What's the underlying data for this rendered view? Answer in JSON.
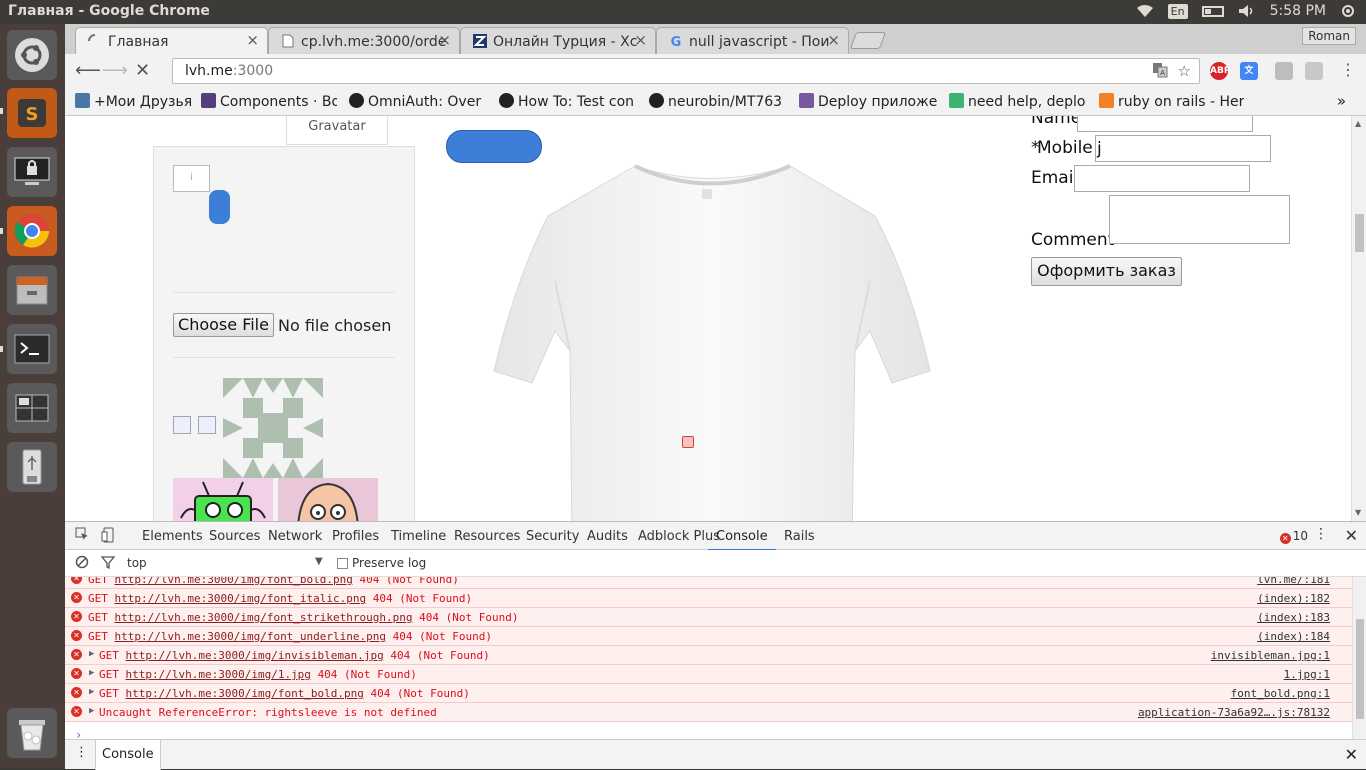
{
  "os": {
    "window_title": "Главная - Google Chrome",
    "language": "En",
    "time": "5:58 PM"
  },
  "launcher": {
    "apps": [
      "ubuntu-dash",
      "sublime-text",
      "lock-screen",
      "chrome",
      "files",
      "terminal",
      "workspaces",
      "usb-drive",
      "trash"
    ]
  },
  "browser": {
    "profile": "Roman",
    "tabs": [
      {
        "label": "Главная",
        "active": true
      },
      {
        "label": "cp.lvh.me:3000/orde",
        "active": false
      },
      {
        "label": "Онлайн Турция - Xc",
        "active": false
      },
      {
        "label": "null javascript - Пои",
        "active": false
      }
    ],
    "address": {
      "host": "lvh.me",
      "port": ":3000"
    },
    "bookmarks": [
      "+Мои Друзья",
      "Components · Bo",
      "OmniAuth: Over",
      "How To: Test con",
      "neurobin/MT763",
      "Deploy приложе",
      "need help, deplo",
      "ruby on rails - Her"
    ],
    "bookmarks_more": "»"
  },
  "page": {
    "gravatar_tab": "Gravatar",
    "small_input_value": "i",
    "choose_file_label": "Choose File",
    "no_file_label": "No file chosen",
    "form": {
      "name_label": "Name",
      "mobile_required": "*",
      "mobile_label": " Mobile",
      "mobile_value": "j",
      "email_label": "Email",
      "comment_label": "Comment",
      "submit_label": "Оформить заказ"
    }
  },
  "devtools": {
    "tabs": [
      "Elements",
      "Sources",
      "Network",
      "Profiles",
      "Timeline",
      "Resources",
      "Security",
      "Audits",
      "Adblock Plus",
      "Console",
      "Rails"
    ],
    "active_tab": "Console",
    "error_count": "10",
    "context": "top",
    "preserve_log": "Preserve log",
    "console_rows": [
      {
        "expandable": false,
        "method": "GET",
        "url": "http://lvh.me:3000/img/font_bold.png",
        "status": "404 (Not Found)",
        "source": "lvh.me/:181"
      },
      {
        "expandable": false,
        "method": "GET",
        "url": "http://lvh.me:3000/img/font_italic.png",
        "status": "404 (Not Found)",
        "source": "(index):182"
      },
      {
        "expandable": false,
        "method": "GET",
        "url": "http://lvh.me:3000/img/font_strikethrough.png",
        "status": "404 (Not Found)",
        "source": "(index):183"
      },
      {
        "expandable": false,
        "method": "GET",
        "url": "http://lvh.me:3000/img/font_underline.png",
        "status": "404 (Not Found)",
        "source": "(index):184"
      },
      {
        "expandable": true,
        "method": "GET",
        "url": "http://lvh.me:3000/img/invisibleman.jpg",
        "status": "404 (Not Found)",
        "source": "invisibleman.jpg:1"
      },
      {
        "expandable": true,
        "method": "GET",
        "url": "http://lvh.me:3000/img/1.jpg",
        "status": "404 (Not Found)",
        "source": "1.jpg:1"
      },
      {
        "expandable": true,
        "method": "GET",
        "url": "http://lvh.me:3000/img/font_bold.png",
        "status": "404 (Not Found)",
        "source": "font_bold.png:1"
      },
      {
        "expandable": true,
        "method": "",
        "url": "",
        "status": "Uncaught ReferenceError: rightsleeve is not defined",
        "source": "application-73a6a92….js:78132"
      }
    ],
    "prompt": "›",
    "drawer_tab": "Console"
  }
}
